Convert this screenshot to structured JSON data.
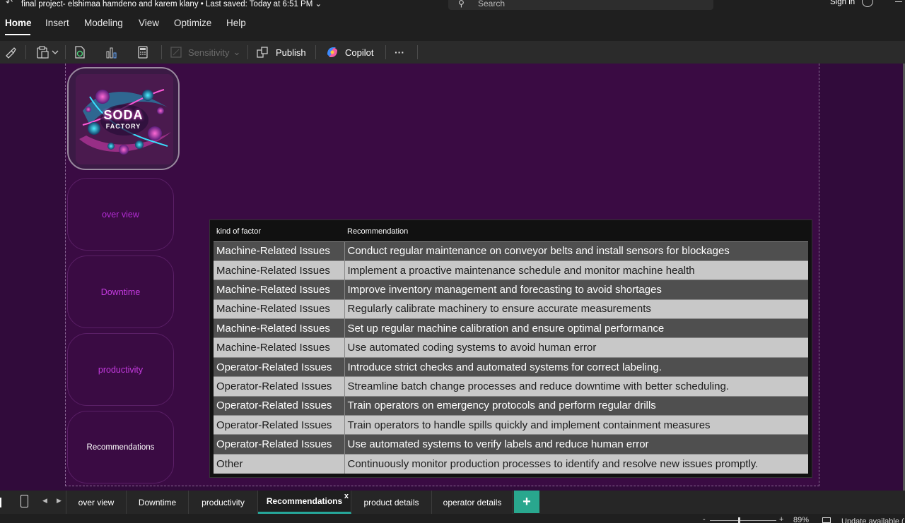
{
  "window": {
    "title": "final project- elshimaa hamdeno and karem klany",
    "saved": "• Last saved: Today at 6:51 PM",
    "search_placeholder": "Search",
    "signin": "Sign in"
  },
  "menu": [
    "Home",
    "Insert",
    "Modeling",
    "View",
    "Optimize",
    "Help"
  ],
  "ribbon": {
    "sensitivity": "Sensitivity",
    "publish": "Publish",
    "copilot": "Copilot",
    "more": "···"
  },
  "logo": {
    "line1": "SODA",
    "line2": "FACTORY"
  },
  "nav": [
    {
      "label": "over view",
      "color": "#b32cd4"
    },
    {
      "label": "Downtime",
      "color": "#c53be0"
    },
    {
      "label": "productivity",
      "color": "#c53be0"
    },
    {
      "label": "Recommendations",
      "color": "#ffffff"
    }
  ],
  "table": {
    "headers": [
      "kind of factor",
      "Recommendation"
    ],
    "rows": [
      [
        "Machine-Related Issues",
        "Conduct regular maintenance on conveyor belts and install sensors for blockages"
      ],
      [
        "Machine-Related Issues",
        "Implement a proactive maintenance schedule and monitor machine health"
      ],
      [
        "Machine-Related Issues",
        "Improve inventory management and forecasting to avoid shortages"
      ],
      [
        "Machine-Related Issues",
        "Regularly calibrate machinery to ensure accurate measurements"
      ],
      [
        "Machine-Related Issues",
        "Set up regular machine calibration and ensure optimal performance"
      ],
      [
        "Machine-Related Issues",
        "Use automated coding systems to avoid human error"
      ],
      [
        "Operator-Related Issues",
        "Introduce strict checks and automated systems for correct labeling."
      ],
      [
        "Operator-Related Issues",
        "Streamline batch change processes and reduce downtime with better scheduling."
      ],
      [
        "Operator-Related Issues",
        "Train operators on emergency protocols and perform regular drills"
      ],
      [
        "Operator-Related Issues",
        "Train operators to handle spills quickly and implement containment measures"
      ],
      [
        "Operator-Related Issues",
        "Use automated systems to verify labels and reduce human error"
      ],
      [
        "Other",
        "Continuously monitor production processes to identify and resolve new issues promptly."
      ]
    ]
  },
  "tabs": [
    "over view",
    "Downtime",
    "productivity",
    "Recommendations",
    "product details",
    "operator details"
  ],
  "active_tab": "Recommendations",
  "add_tab": "+",
  "status": {
    "zoom": "89%",
    "update": "Update available ("
  }
}
